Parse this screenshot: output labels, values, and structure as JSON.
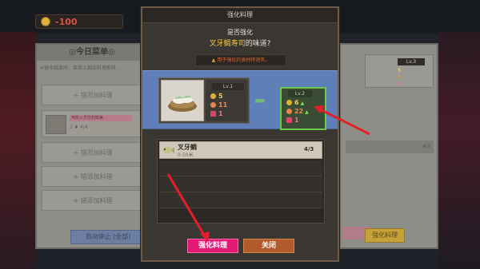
{
  "hud": {
    "coins": "-100"
  },
  "left_panel": {
    "title": "◎今日菜单◎",
    "note": "※营业结束时，菜单上剩余料理都将…",
    "add_slot_label": "+ 错添加料理",
    "dish_tag": "用炭火烹饪的鲜美…",
    "dish_meta": "1 ♦ 4/4",
    "auto_stop": "自动停止 (全部)"
  },
  "right_panel": {
    "lv": "Lv.3",
    "stats": [
      "5",
      "4",
      "1"
    ],
    "row_text": "4/1",
    "button": "强化料理"
  },
  "dialog": {
    "title": "强化料理",
    "question_line1": "是否强化",
    "dish_name": "叉牙鲷寿司",
    "question_suffix": "的味道?",
    "warning": "用于强化的食材将消失。",
    "current": {
      "level": "Lv.1",
      "coin": "5",
      "taste": "11",
      "heart": "1"
    },
    "arrows": "»»",
    "next": {
      "level": "Lv.2",
      "coin": "6",
      "taste": "22",
      "heart": "1",
      "up_glyph": "▲"
    },
    "ingredient": {
      "name": "叉牙鲷",
      "size": "0-50米",
      "count": "4/3"
    },
    "enhance_button": "强化料理",
    "close_button": "关闭"
  },
  "colors": {
    "accent_pink": "#e21a76",
    "upgrade_green": "#7be34d",
    "annotation_red": "#e3202a",
    "highlight_gold": "#f1c743"
  }
}
